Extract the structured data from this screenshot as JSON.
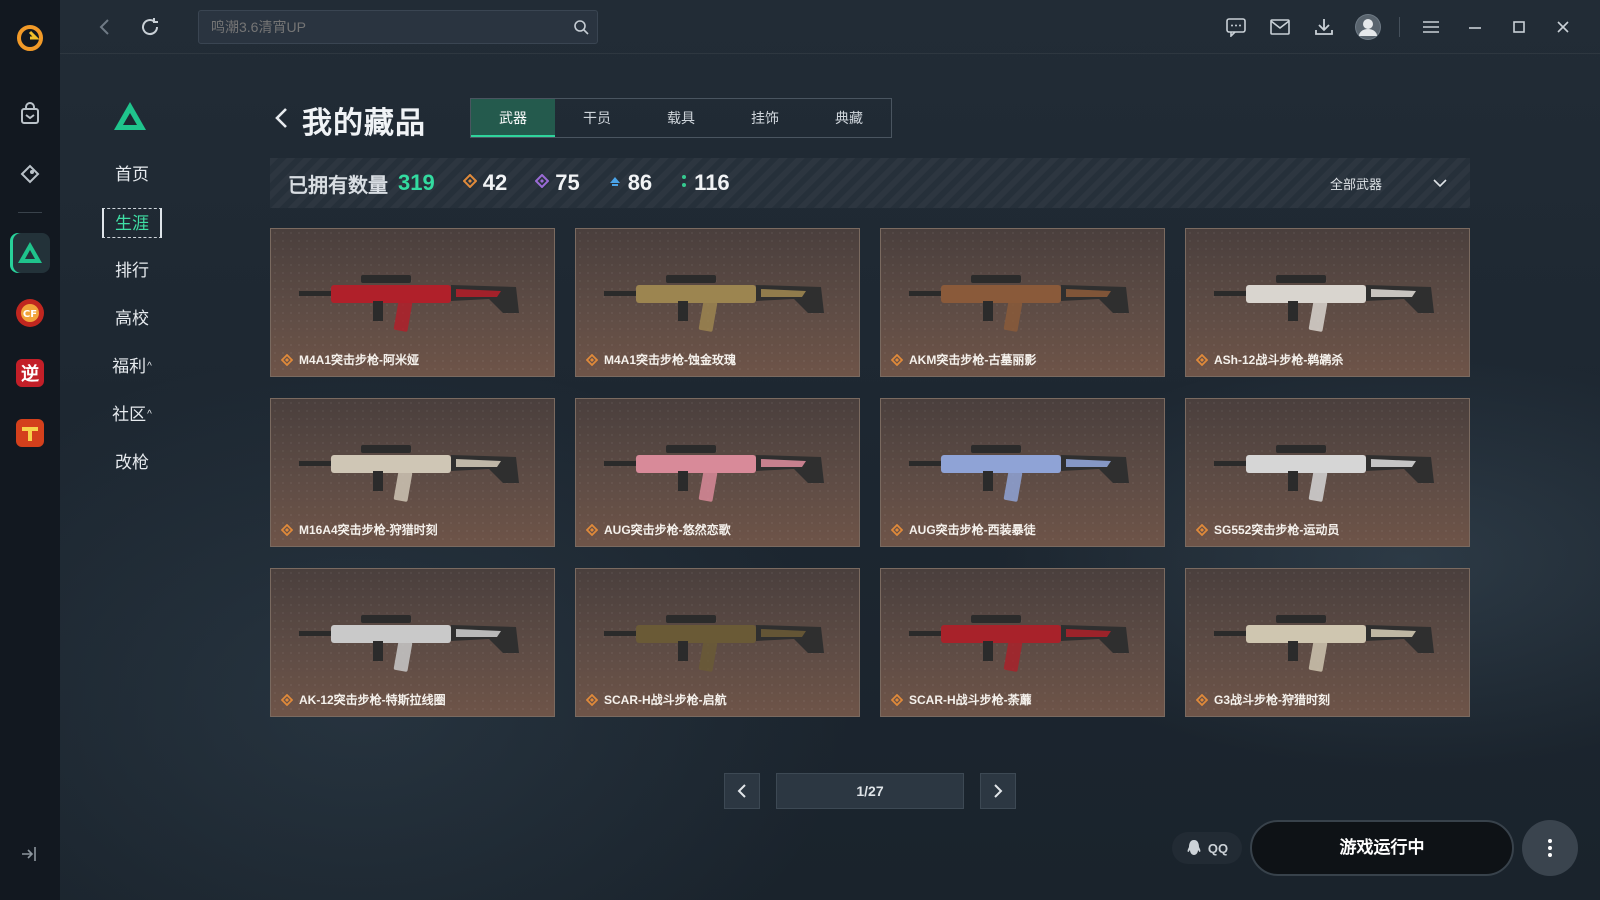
{
  "search": {
    "placeholder": "鸣潮3.6清宵UP"
  },
  "subnav": {
    "items": [
      {
        "label": "首页"
      },
      {
        "label": "生涯",
        "active": true
      },
      {
        "label": "排行"
      },
      {
        "label": "高校"
      },
      {
        "label": "福利",
        "caret": "^"
      },
      {
        "label": "社区",
        "caret": "^"
      },
      {
        "label": "改枪"
      }
    ]
  },
  "header": {
    "title": "我的藏品"
  },
  "tabs": [
    {
      "label": "武器",
      "active": true
    },
    {
      "label": "干员"
    },
    {
      "label": "载具"
    },
    {
      "label": "挂饰"
    },
    {
      "label": "典藏"
    }
  ],
  "stats": {
    "owned_label": "已拥有数量",
    "owned_count": "319",
    "orange": "42",
    "purple": "75",
    "blue": "86",
    "green": "116",
    "filter": "全部武器"
  },
  "cards": [
    {
      "name": "M4A1突击步枪-阿米娅",
      "accent": "#b0202a"
    },
    {
      "name": "M4A1突击步枪-蚀金玫瑰",
      "accent": "#9c8550"
    },
    {
      "name": "AKM突击步枪-古墓丽影",
      "accent": "#8a5a3a"
    },
    {
      "name": "ASh-12战斗步枪-鹈鹕杀",
      "accent": "#d9d5cf"
    },
    {
      "name": "M16A4突击步枪-狩猎时刻",
      "accent": "#cfc6b5"
    },
    {
      "name": "AUG突击步枪-悠然恋歌",
      "accent": "#d88a99"
    },
    {
      "name": "AUG突击步枪-西装暴徒",
      "accent": "#8fa3d6"
    },
    {
      "name": "SG552突击步枪-运动员",
      "accent": "#d6d6d6"
    },
    {
      "name": "AK-12突击步枪-特斯拉线圈",
      "accent": "#c9c9c9"
    },
    {
      "name": "SCAR-H战斗步枪-启航",
      "accent": "#6a5a36"
    },
    {
      "name": "SCAR-H战斗步枪-荼蘼",
      "accent": "#a8222a"
    },
    {
      "name": "G3战斗步枪-狩猎时刻",
      "accent": "#cfc6b0"
    }
  ],
  "pager": {
    "text": "1/27"
  },
  "bottom": {
    "qq": "QQ",
    "run": "游戏运行中"
  },
  "colors": {
    "accent_green": "#33dba0",
    "rarity_orange": "#e08a3a",
    "rarity_purple": "#9b6bd6",
    "rarity_blue": "#4aa3e8",
    "rarity_green": "#35c98f"
  }
}
